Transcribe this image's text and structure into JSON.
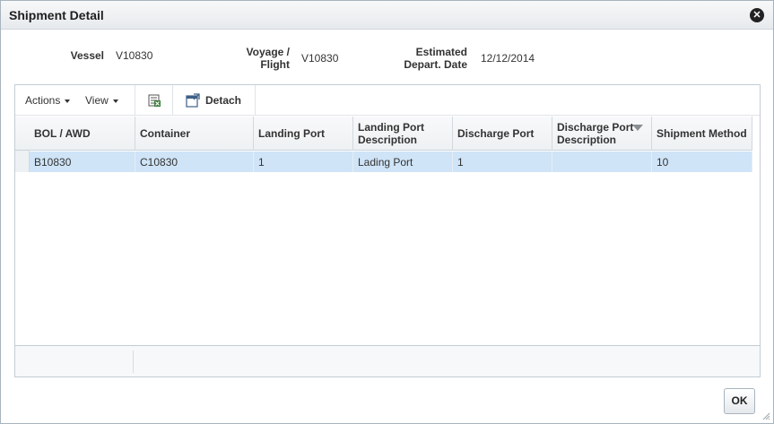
{
  "dialog": {
    "title": "Shipment Detail",
    "close_glyph": "✕"
  },
  "header_fields": {
    "vessel_label": "Vessel",
    "vessel_value": "V10830",
    "voyage_label_line1": "Voyage /",
    "voyage_label_line2": "Flight",
    "voyage_value": "V10830",
    "depart_label_line1": "Estimated",
    "depart_label_line2": "Depart. Date",
    "depart_value": "12/12/2014"
  },
  "toolbar": {
    "actions_label": "Actions",
    "view_label": "View",
    "detach_label": "Detach",
    "export_icon": "export-excel-icon",
    "detach_icon": "detach-icon"
  },
  "table": {
    "columns": [
      {
        "line1": "BOL / AWD",
        "line2": ""
      },
      {
        "line1": "Container",
        "line2": ""
      },
      {
        "line1": "Landing Port",
        "line2": ""
      },
      {
        "line1": "Landing Port",
        "line2": "Description"
      },
      {
        "line1": "Discharge Port",
        "line2": ""
      },
      {
        "line1": "Discharge Port",
        "line2": "Description"
      },
      {
        "line1": "Shipment Method",
        "line2": ""
      }
    ],
    "rows": [
      [
        "B10830",
        "C10830",
        "1",
        "Lading Port",
        "1",
        "",
        "10"
      ]
    ],
    "selected_row_color": "#cfe4f7"
  },
  "footer": {
    "ok_label": "OK"
  }
}
